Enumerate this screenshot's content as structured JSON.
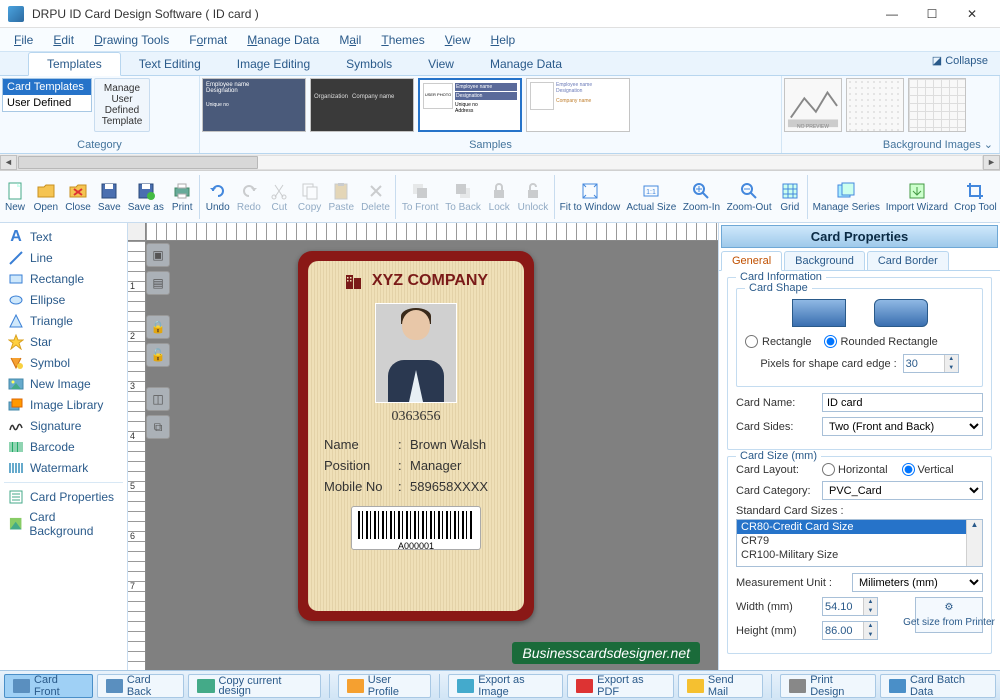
{
  "titlebar": {
    "title": "DRPU ID Card Design Software ( ID card )"
  },
  "menu": {
    "file": "File",
    "edit": "Edit",
    "drawing": "Drawing Tools",
    "format": "Format",
    "manage": "Manage Data",
    "mail": "Mail",
    "themes": "Themes",
    "view": "View",
    "help": "Help"
  },
  "ribbontabs": {
    "templates": "Templates",
    "textedit": "Text Editing",
    "imgedit": "Image Editing",
    "symbols": "Symbols",
    "view": "View",
    "managedata": "Manage Data",
    "collapse": "Collapse"
  },
  "ribbon": {
    "category_label": "Category",
    "categories": {
      "card_templates": "Card Templates",
      "user_defined": "User Defined"
    },
    "manage_btn": "Manage User Defined Template",
    "samples_label": "Samples",
    "bg_label": "Background Images"
  },
  "samplecard": {
    "emp": "Employee name",
    "desig": "Designation",
    "org": "Organization",
    "comp": "Company name",
    "uniq": "Unique no",
    "addr": "Address",
    "userphoto": "USER PHOTO"
  },
  "bgprev": {
    "nopreview": "NO PREVIEW"
  },
  "toolbar": {
    "new": "New",
    "open": "Open",
    "close": "Close",
    "save": "Save",
    "saveas": "Save as",
    "print": "Print",
    "undo": "Undo",
    "redo": "Redo",
    "cut": "Cut",
    "copy": "Copy",
    "paste": "Paste",
    "delete": "Delete",
    "tofront": "To Front",
    "toback": "To Back",
    "lock": "Lock",
    "unlock": "Unlock",
    "fitwin": "Fit to Window",
    "actual": "Actual Size",
    "zoomin": "Zoom-In",
    "zoomout": "Zoom-Out",
    "grid": "Grid",
    "mseries": "Manage Series",
    "iwizard": "Import Wizard",
    "crop": "Crop Tool"
  },
  "lefttools": {
    "text": "Text",
    "line": "Line",
    "rectangle": "Rectangle",
    "ellipse": "Ellipse",
    "triangle": "Triangle",
    "star": "Star",
    "symbol": "Symbol",
    "newimg": "New Image",
    "imglib": "Image Library",
    "signature": "Signature",
    "barcode": "Barcode",
    "watermark": "Watermark",
    "cardprops": "Card Properties",
    "cardbg": "Card Background"
  },
  "card": {
    "company": "XYZ COMPANY",
    "id": "0363656",
    "name_lbl": "Name",
    "name_val": "Brown Walsh",
    "pos_lbl": "Position",
    "pos_val": "Manager",
    "mob_lbl": "Mobile No",
    "mob_val": "589658XXXX",
    "barcode": "A000001"
  },
  "props": {
    "title": "Card Properties",
    "tab_general": "General",
    "tab_bg": "Background",
    "tab_border": "Card Border",
    "cardinfo": "Card Information",
    "cardshape": "Card Shape",
    "shape_rect": "Rectangle",
    "shape_rrect": "Rounded Rectangle",
    "pixels_lbl": "Pixels for shape card edge :",
    "pixels_val": "30",
    "cardname_lbl": "Card Name:",
    "cardname_val": "ID card",
    "cardsides_lbl": "Card Sides:",
    "cardsides_val": "Two (Front and Back)",
    "cardsize": "Card Size (mm)",
    "layout_lbl": "Card Layout:",
    "layout_h": "Horizontal",
    "layout_v": "Vertical",
    "cat_lbl": "Card Category:",
    "cat_val": "PVC_Card",
    "std_lbl": "Standard Card Sizes :",
    "std_cr80": "CR80-Credit Card Size",
    "std_cr79": "CR79",
    "std_cr100": "CR100-Military Size",
    "munit_lbl": "Measurement Unit :",
    "munit_val": "Milimeters (mm)",
    "width_lbl": "Width  (mm)",
    "width_val": "54.10",
    "height_lbl": "Height (mm)",
    "height_val": "86.00",
    "getsize": "Get size from Printer"
  },
  "bottom": {
    "cardfront": "Card Front",
    "cardback": "Card Back",
    "copycur": "Copy current design",
    "userprofile": "User Profile",
    "expimg": "Export as Image",
    "exppdf": "Export as PDF",
    "sendmail": "Send Mail",
    "printdesign": "Print Design",
    "batch": "Card Batch Data"
  },
  "watermark": "Businesscardsdesigner.net"
}
